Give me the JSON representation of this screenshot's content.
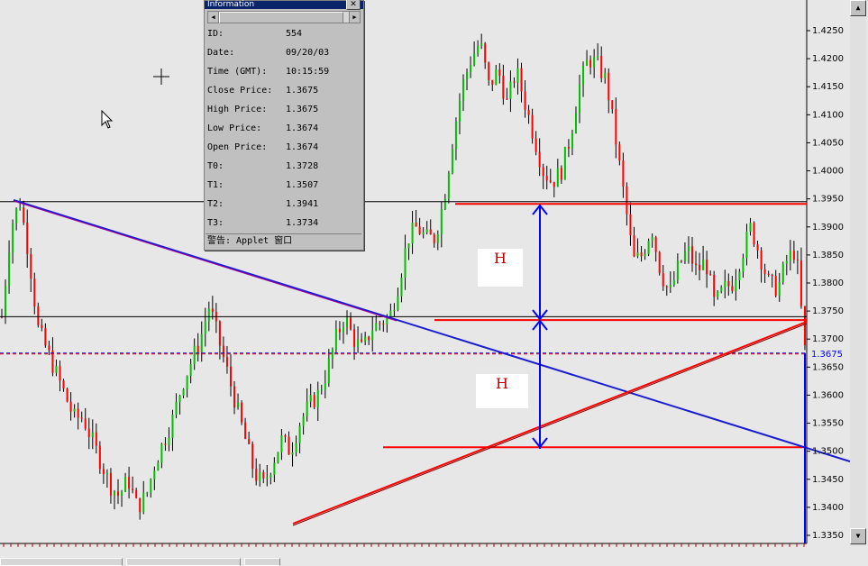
{
  "info_window": {
    "title": "Information",
    "close_glyph": "✕",
    "rows": [
      {
        "label": "ID:",
        "value": "554"
      },
      {
        "label": "Date:",
        "value": "09/20/03"
      },
      {
        "label": "Time (GMT):",
        "value": "10:15:59"
      },
      {
        "label": "Close Price:",
        "value": "1.3675"
      },
      {
        "label": "High Price:",
        "value": "1.3675"
      },
      {
        "label": "Low Price:",
        "value": "1.3674"
      },
      {
        "label": "Open Price:",
        "value": "1.3674"
      },
      {
        "label": "T0:",
        "value": "1.3728"
      },
      {
        "label": "T1:",
        "value": "1.3507"
      },
      {
        "label": "T2:",
        "value": "1.3941"
      },
      {
        "label": "T3:",
        "value": "1.3734"
      }
    ],
    "status": "警告: Applet 窗口"
  },
  "annotations": {
    "h_upper": "H",
    "h_lower": "H"
  },
  "chart_data": {
    "type": "candlestick",
    "title": "",
    "ylim": [
      1.333,
      1.4295
    ],
    "y_ticks": [
      "1.4250",
      "1.4200",
      "1.4150",
      "1.4100",
      "1.4050",
      "1.4000",
      "1.3950",
      "1.3900",
      "1.3850",
      "1.3800",
      "1.3750",
      "1.3700",
      "1.3650",
      "1.3600",
      "1.3550",
      "1.3500",
      "1.3450",
      "1.3400",
      "1.3350"
    ],
    "current_price_label": "1.3675",
    "current_price": 1.3675,
    "colors": {
      "up": "#00c000",
      "down": "#ff0000",
      "trend_blue": "#1a1ad0",
      "level_red": "#ff0000",
      "current": "#0000ff"
    },
    "price_path": [
      1.374,
      1.39,
      1.3945,
      1.385,
      1.372,
      1.368,
      1.364,
      1.36,
      1.356,
      1.356,
      1.352,
      1.348,
      1.344,
      1.342,
      1.345,
      1.34,
      1.342,
      1.348,
      1.352,
      1.356,
      1.362,
      1.366,
      1.37,
      1.376,
      1.37,
      1.364,
      1.358,
      1.352,
      1.346,
      1.344,
      1.348,
      1.352,
      1.35,
      1.355,
      1.358,
      1.36,
      1.364,
      1.37,
      1.374,
      1.37,
      1.368,
      1.372,
      1.373,
      1.374,
      1.38,
      1.388,
      1.39,
      1.388,
      1.388,
      1.395,
      1.406,
      1.415,
      1.42,
      1.423,
      1.415,
      1.418,
      1.412,
      1.418,
      1.412,
      1.406,
      1.4,
      1.398,
      1.4,
      1.406,
      1.415,
      1.42,
      1.419,
      1.416,
      1.406,
      1.395,
      1.384,
      1.385,
      1.39,
      1.382,
      1.378,
      1.383,
      1.386,
      1.382,
      1.384,
      1.376,
      1.379,
      1.38,
      1.385,
      1.39,
      1.385,
      1.38,
      1.379,
      1.384,
      1.386,
      1.368
    ]
  },
  "levels": {
    "t2_level": 1.3941,
    "t3_level": 1.3734,
    "t1_level": 1.3507,
    "black_upper": 1.3945,
    "black_mid": 1.374
  }
}
